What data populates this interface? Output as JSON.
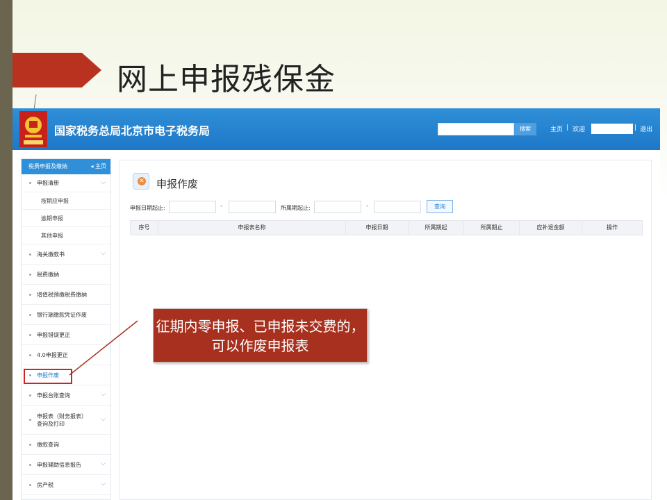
{
  "slide": {
    "title": "网上申报残保金",
    "callout": "征期内零申报、已申报未交费的，可以作废申报表"
  },
  "header": {
    "site_title": "国家税务总局北京市电子税务局",
    "search_button": "搜索",
    "home_link": "主页",
    "welcome": "欢迎",
    "logout": "退出"
  },
  "sidebar": {
    "title": "税费申报及缴纳",
    "home": "主页",
    "items": [
      {
        "label": "申报清册",
        "type": "item",
        "chevron": true
      },
      {
        "label": "按期应申报",
        "type": "sub"
      },
      {
        "label": "逾期申报",
        "type": "sub"
      },
      {
        "label": "其他申报",
        "type": "sub"
      },
      {
        "label": "海关缴款书",
        "type": "item",
        "chevron": true
      },
      {
        "label": "税费缴纳",
        "type": "item",
        "chevron": false
      },
      {
        "label": "增值税预缴税费缴纳",
        "type": "item",
        "chevron": false
      },
      {
        "label": "银行端缴款凭证作废",
        "type": "item",
        "chevron": false
      },
      {
        "label": "申报错误更正",
        "type": "item",
        "chevron": false
      },
      {
        "label": "4.0申报更正",
        "type": "item",
        "chevron": false
      },
      {
        "label": "申报作废",
        "type": "item",
        "chevron": false,
        "active": true
      },
      {
        "label": "申报台账查询",
        "type": "item",
        "chevron": true
      },
      {
        "label": "申报表（财务报表）查询及打印",
        "type": "item",
        "chevron": true
      },
      {
        "label": "缴款查询",
        "type": "item",
        "chevron": false
      },
      {
        "label": "申报辅助信息报告",
        "type": "item",
        "chevron": true
      },
      {
        "label": "房产税",
        "type": "item",
        "chevron": true
      }
    ]
  },
  "main": {
    "heading": "申报作废",
    "filter_date_label": "申报日期起止:",
    "filter_period_label": "所属期起止:",
    "query_button": "查询",
    "columns": [
      "序号",
      "申报表名称",
      "申报日期",
      "所属期起",
      "所属期止",
      "应补退金额",
      "操作"
    ]
  },
  "colors": {
    "header_blue": "#1e78c8",
    "title_arrow": "#b8321f",
    "callout_bg": "#a8301e",
    "active_outline": "#d0202a"
  }
}
